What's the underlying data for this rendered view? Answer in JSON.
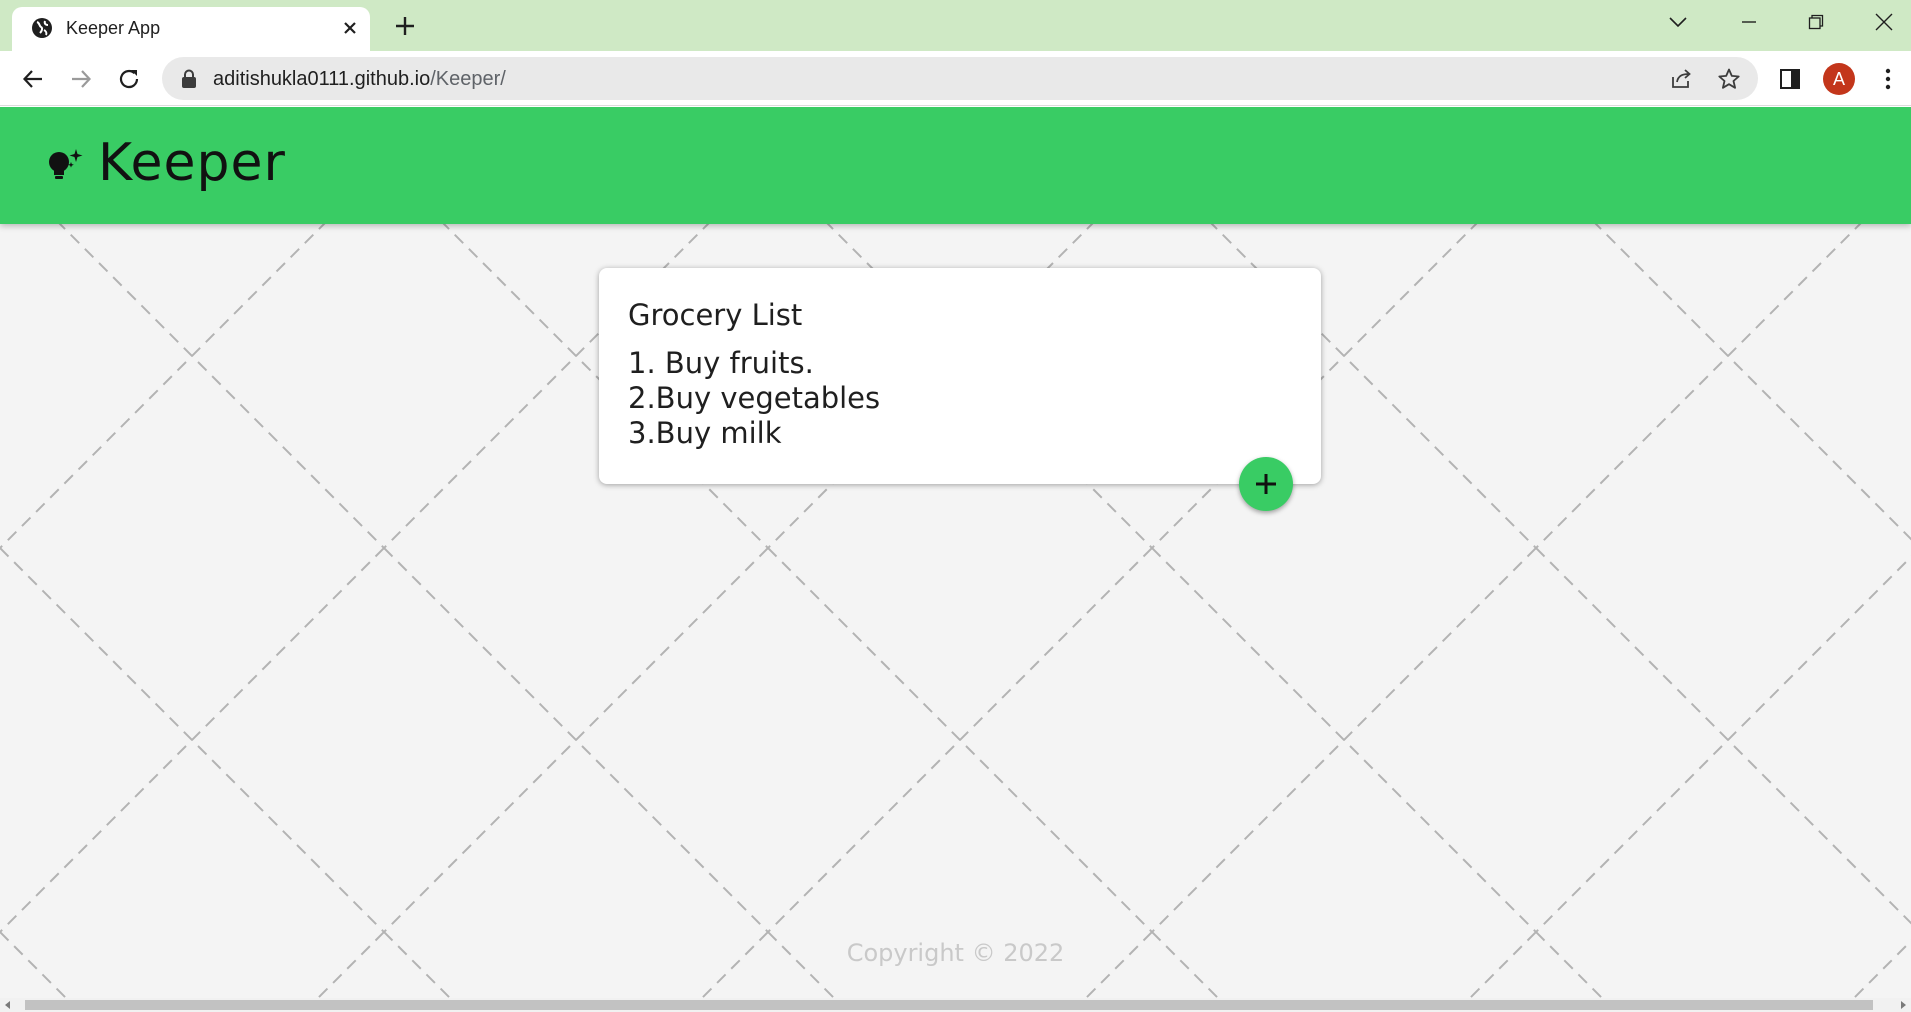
{
  "browser": {
    "tab_title": "Keeper App",
    "url_host": "aditishukla0111.github.io",
    "url_path": "/Keeper/",
    "avatar_letter": "A"
  },
  "app": {
    "logo_text": "Keeper",
    "accent_color": "#39cc64"
  },
  "note": {
    "title": "Grocery List",
    "lines": [
      "1. Buy fruits.",
      "2.Buy vegetables",
      "3.Buy milk"
    ]
  },
  "footer": {
    "copyright": "Copyright © 2022"
  }
}
